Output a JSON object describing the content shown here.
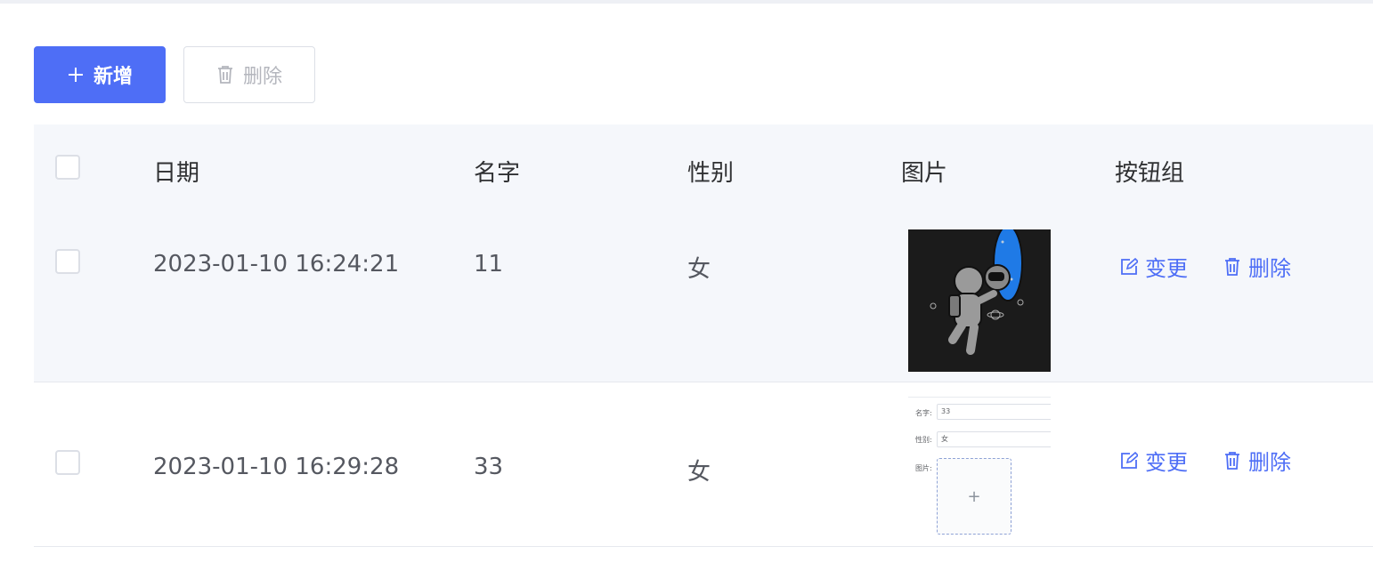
{
  "toolbar": {
    "add_label": "新增",
    "delete_label": "删除",
    "add_icon": "plus-icon",
    "delete_icon": "trash-icon",
    "primary_color": "#4e6ef6"
  },
  "table": {
    "columns": [
      "日期",
      "名字",
      "性别",
      "图片",
      "按钮组"
    ],
    "rows": [
      {
        "date": "2023-01-10 16:24:21",
        "name": "11",
        "gender": "女",
        "image": "astronaut-thumbnail",
        "actions": {
          "edit": "变更",
          "delete": "删除"
        }
      },
      {
        "date": "2023-01-10 16:29:28",
        "name": "33",
        "gender": "女",
        "image": "form-screenshot-thumbnail",
        "thumb_form": {
          "name_label": "名字:",
          "name_value": "33",
          "gender_label": "性别:",
          "gender_value": "女",
          "image_label": "图片:",
          "upload_symbol": "+"
        },
        "actions": {
          "edit": "变更",
          "delete": "删除"
        }
      }
    ]
  }
}
